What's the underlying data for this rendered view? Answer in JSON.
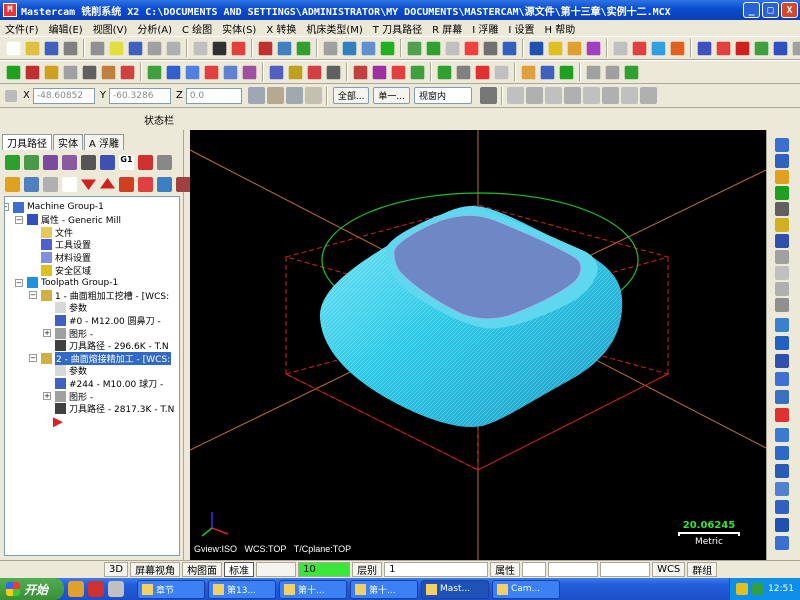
{
  "window": {
    "title": "Mastercam 铣削系统  X2  C:\\DOCUMENTS AND SETTINGS\\ADMINISTRATOR\\MY DOCUMENTS\\MASTERCAM\\源文件\\第十三章\\实例十二.MCX",
    "minimize": "_",
    "maximize": "□",
    "close": "X"
  },
  "menu": [
    "文件(F)",
    "编辑(E)",
    "视图(V)",
    "分析(A)",
    "C 绘图",
    "实体(S)",
    "X 转换",
    "机床类型(M)",
    "T 刀具路径",
    "R 屏幕",
    "I 浮雕",
    "I 设置",
    "H 帮助"
  ],
  "coordbar": {
    "x_label": "X",
    "x_value": "-48.60852",
    "y_label": "Y",
    "y_value": "-60.3286",
    "z_label": "Z",
    "z_value": "0.0",
    "all_button": "全部...",
    "single_button": "单一...",
    "view_select": "视窗内"
  },
  "status_label": "状态栏",
  "panel": {
    "tabs": [
      "刀具路径",
      "实体",
      "A 浮雕"
    ],
    "tree": [
      {
        "text": "Machine Group-1",
        "level": 0,
        "icon": "machine-group-icon",
        "color": "#3b6fcf"
      },
      {
        "text": "属性 - Generic Mill",
        "level": 1,
        "icon": "properties-icon",
        "color": "#3050c0"
      },
      {
        "text": "文件",
        "level": 2,
        "icon": "folder-icon",
        "color": "#e8c85a"
      },
      {
        "text": "工具设置",
        "level": 2,
        "icon": "tool-settings-icon",
        "color": "#5060d0"
      },
      {
        "text": "材料设置",
        "level": 2,
        "icon": "material-icon",
        "color": "#8090e0"
      },
      {
        "text": "安全区域",
        "level": 2,
        "icon": "warning-icon",
        "color": "#e0c020"
      },
      {
        "text": "Toolpath Group-1",
        "level": 1,
        "icon": "toolpath-group-icon",
        "color": "#2090e0"
      },
      {
        "text": "1 - 曲面粗加工挖槽 - [WCS:",
        "level": 2,
        "icon": "operation-folder-icon",
        "color": "#d0b040"
      },
      {
        "text": "参数",
        "level": 3,
        "icon": "params-icon",
        "color": "#d8d8d8"
      },
      {
        "text": "#0 - M12.00 圆鼻刀 - ",
        "level": 3,
        "icon": "tool-icon",
        "color": "#4060c0"
      },
      {
        "text": "图形 - ",
        "level": 3,
        "icon": "geometry-icon",
        "color": "#a0a0a0"
      },
      {
        "text": "刀具路径 - 296.6K - T.N",
        "level": 3,
        "icon": "toolpath-icon",
        "color": "#404040"
      },
      {
        "text": "2 - 曲面熔接精加工 - [WCS:",
        "level": 2,
        "icon": "operation-folder-icon",
        "color": "#d0b040",
        "selected": true
      },
      {
        "text": "参数",
        "level": 3,
        "icon": "params-icon",
        "color": "#d8d8d8"
      },
      {
        "text": "#244 - M10.00 球刀 - ",
        "level": 3,
        "icon": "tool-icon",
        "color": "#4060c0"
      },
      {
        "text": "图形 - ",
        "level": 3,
        "icon": "geometry-icon",
        "color": "#a0a0a0"
      },
      {
        "text": "刀具路径 - 2817.3K - T.N",
        "level": 3,
        "icon": "toolpath-icon",
        "color": "#404040"
      }
    ]
  },
  "viewport": {
    "gview": "Gview:ISO",
    "wcs": "WCS:TOP",
    "tcplane": "T/Cplane:TOP",
    "scale_value": "20.06245",
    "scale_unit": "Metric"
  },
  "bottombar": {
    "view_3d": "3D",
    "screen_view": "屏幕视角",
    "construct_plane": "构图面",
    "z_value": "10",
    "ime_label": "标准",
    "level_label": "层别",
    "level_value": "1",
    "attributes": "属性",
    "wcs": "WCS",
    "group": "群组"
  },
  "taskbar": {
    "start": "开始",
    "tasks": [
      "章节",
      "第13...",
      "第十...",
      "第十...",
      "Mast...",
      "Cam..."
    ],
    "clock": "12:51"
  },
  "colors": {
    "title_bar": "#0a4ccf",
    "viewport_bg": "#000000",
    "part_surface": "#29c9e8",
    "part_top_face": "#6d88c4",
    "stock_outline": "#d42222",
    "circle_outline": "#1fbf2f",
    "axis_lines": "#c07030",
    "scale_value": "#36e136"
  }
}
